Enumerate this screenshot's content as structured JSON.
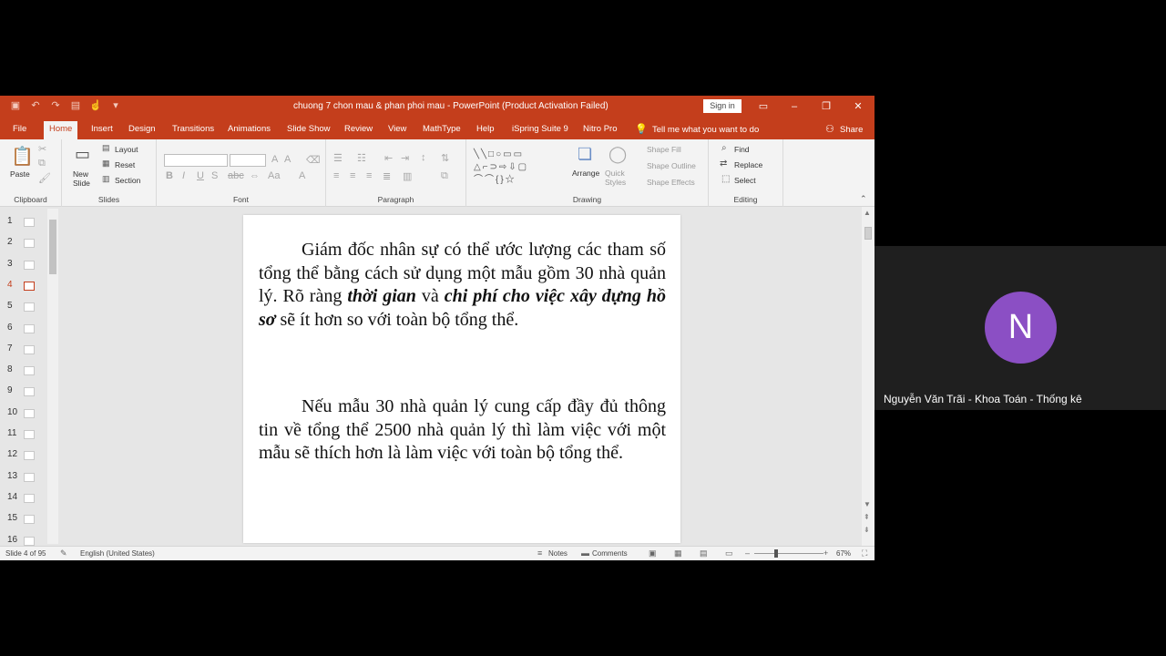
{
  "window": {
    "title": "chuong 7 chon mau & phan phoi mau  -  PowerPoint (Product Activation Failed)",
    "sign_in": "Sign in",
    "accent": "#c43e1c"
  },
  "tabs": [
    "File",
    "Home",
    "Insert",
    "Design",
    "Transitions",
    "Animations",
    "Slide Show",
    "Review",
    "View",
    "MathType",
    "Help",
    "iSpring Suite 9",
    "Nitro Pro"
  ],
  "active_tab": "Home",
  "tell_me": "Tell me what you want to do",
  "share": "Share",
  "ribbon": {
    "clipboard": {
      "label": "Clipboard",
      "paste": "Paste"
    },
    "slides": {
      "label": "Slides",
      "new_slide": "New Slide",
      "layout": "Layout",
      "reset": "Reset",
      "section": "Section"
    },
    "font": {
      "label": "Font"
    },
    "paragraph": {
      "label": "Paragraph"
    },
    "drawing": {
      "label": "Drawing",
      "arrange": "Arrange",
      "quick_styles": "Quick Styles",
      "shape_fill": "Shape Fill",
      "shape_outline": "Shape Outline",
      "shape_effects": "Shape Effects"
    },
    "editing": {
      "label": "Editing",
      "find": "Find",
      "replace": "Replace",
      "select": "Select"
    }
  },
  "thumbnails": [
    "1",
    "2",
    "3",
    "4",
    "5",
    "6",
    "7",
    "8",
    "9",
    "10",
    "11",
    "12",
    "13",
    "14",
    "15",
    "16"
  ],
  "active_slide": "4",
  "slide": {
    "para1_a": "Giám đốc nhân sự có thể ước lượng các tham số tổng thể bằng cách sử dụng một mẫu gồm 30 nhà quản lý. Rõ ràng ",
    "para1_b": "thời gian",
    "para1_c": " và ",
    "para1_d": "chi phí cho việc xây dựng hồ sơ",
    "para1_e": " sẽ ít hơn so với toàn bộ tổng thể.",
    "para2": "Nếu mẫu 30 nhà quản lý cung cấp đầy đủ thông tin về tổng thể 2500 nhà quản lý thì làm việc với một mẫu sẽ thích hơn là làm việc với toàn bộ tổng thể."
  },
  "status": {
    "slide_info": "Slide 4 of 95",
    "language": "English (United States)",
    "notes": "Notes",
    "comments": "Comments",
    "zoom": "67%"
  },
  "call": {
    "initial": "N",
    "name": "Nguyễn Văn Trãi - Khoa Toán - Thống kê",
    "avatar_color": "#8b4fc4"
  }
}
